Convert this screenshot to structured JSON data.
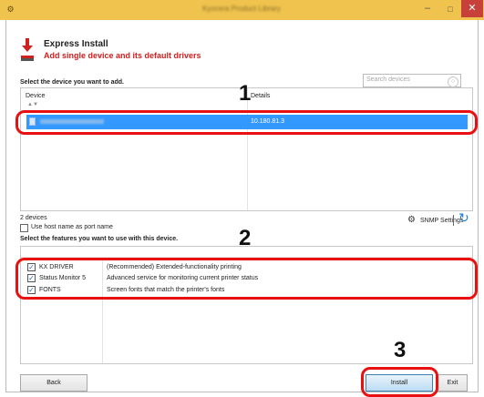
{
  "window": {
    "title": "Kyocera Product Library",
    "minimize_glyph": "–",
    "maximize_glyph": "□",
    "close_glyph": "✕",
    "app_icon": "gear-icon"
  },
  "header": {
    "title": "Express Install",
    "subtitle": "Add single device and its default drivers",
    "icon": "download-arrow-icon"
  },
  "device_section": {
    "label": "Select the device you want to add.",
    "search_placeholder": "Search devices",
    "columns": [
      "Device",
      "Details"
    ],
    "rows": [
      {
        "name": "",
        "details": "10.180.81.3",
        "selected": true
      }
    ],
    "count_text": "2 devices",
    "use_host_name_label": "Use host name as port name",
    "snmp_settings_label": "SNMP Settings"
  },
  "features_section": {
    "label": "Select the features you want to use with this device.",
    "features": [
      {
        "name": "KX DRIVER",
        "description": "(Recommended) Extended-functionality printing",
        "checked": true
      },
      {
        "name": "Status Monitor 5",
        "description": "Advanced service for monitoring current printer status",
        "checked": true
      },
      {
        "name": "FONTS",
        "description": "Screen fonts that match the printer's fonts",
        "checked": true
      }
    ]
  },
  "buttons": {
    "back": "Back",
    "install": "Install",
    "exit": "Exit"
  },
  "annotations": [
    "1",
    "2",
    "3"
  ],
  "colors": {
    "titlebar": "#f0c34e",
    "selection": "#3399ff",
    "subtitle": "#d02020",
    "annotation": "#e81010",
    "close_button": "#c7403a"
  }
}
